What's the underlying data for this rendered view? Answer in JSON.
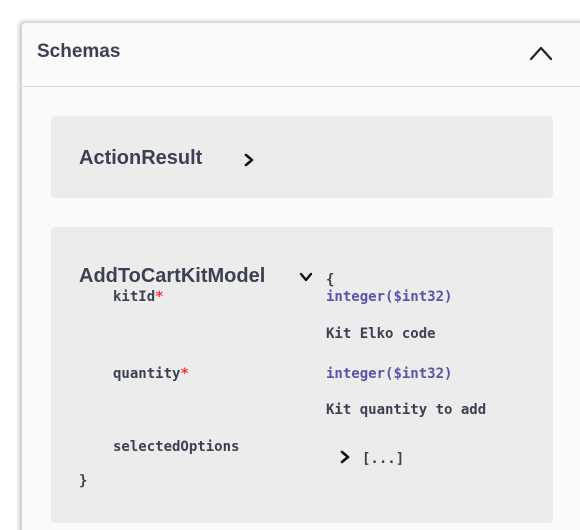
{
  "panel": {
    "title": "Schemas",
    "toggle_icon": "chevron-up-icon"
  },
  "models": [
    {
      "name": "ActionResult",
      "expanded": false,
      "toggle_icon": "chevron-right-icon"
    },
    {
      "name": "AddToCartKitModel",
      "expanded": true,
      "toggle_icon": "chevron-down-icon",
      "open_brace": "{",
      "close_brace": "}",
      "properties": [
        {
          "name": "kitId",
          "required_mark": "*",
          "type": "integer",
          "format": "($int32)",
          "description": "Kit Elko code"
        },
        {
          "name": "quantity",
          "required_mark": "*",
          "type": "integer",
          "format": "($int32)",
          "description": "Kit quantity to add"
        },
        {
          "name": "selectedOptions",
          "required_mark": "",
          "collapsed_value": "[...]",
          "toggle_icon": "chevron-right-icon"
        }
      ]
    }
  ],
  "colors": {
    "text": "#3b4151",
    "type": "#5555aa",
    "required": "#ff3333",
    "card_bg": "#ececec",
    "panel_bg": "#fafafa"
  }
}
